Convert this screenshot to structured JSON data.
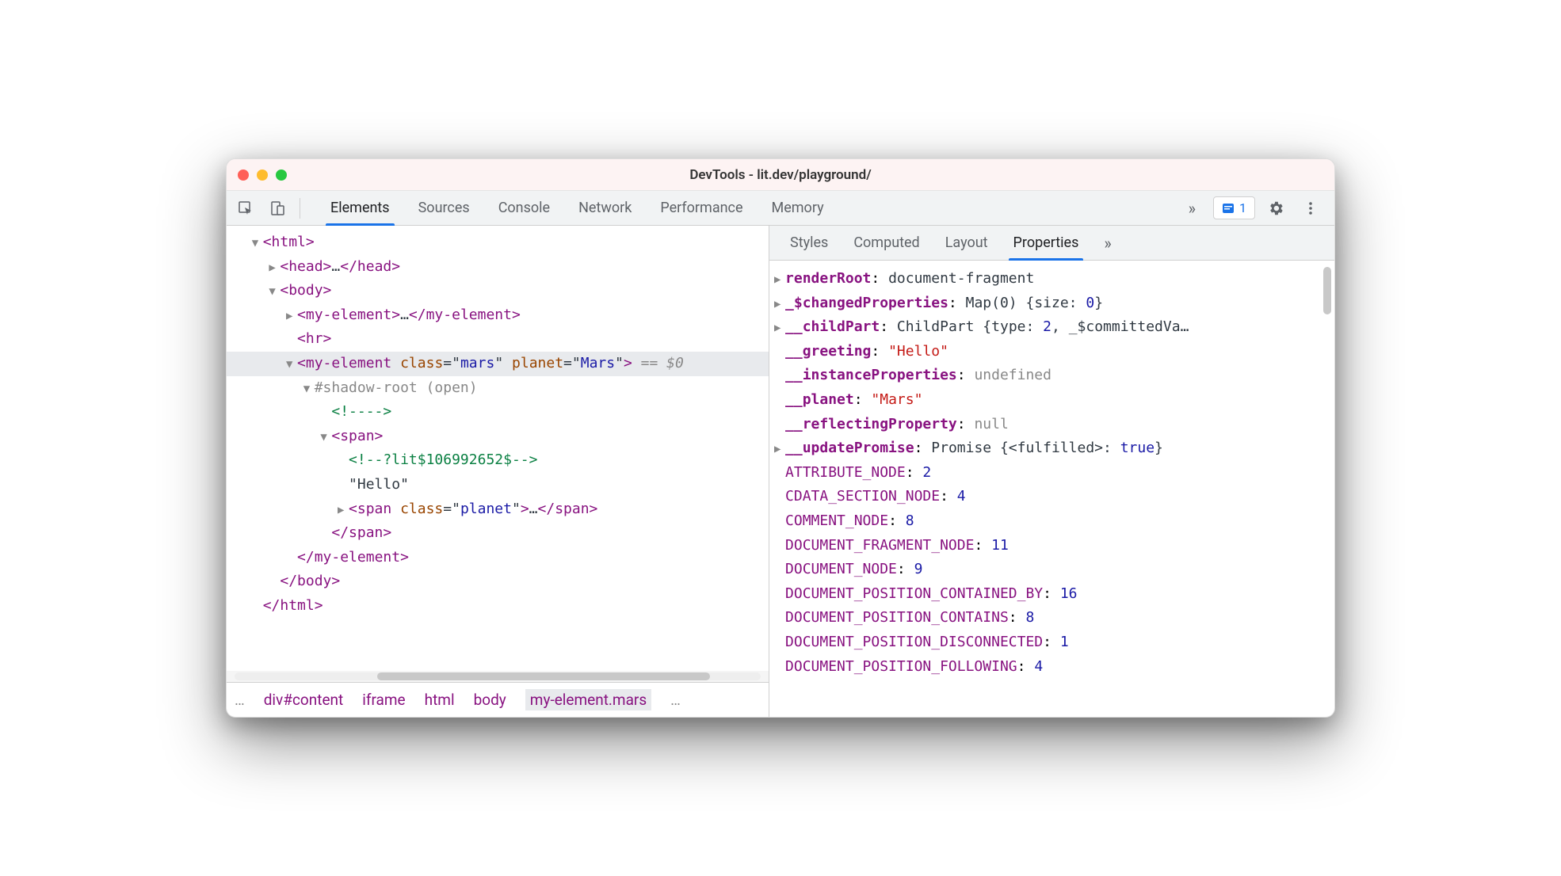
{
  "window": {
    "title": "DevTools - lit.dev/playground/"
  },
  "toolbar": {
    "tabs": [
      "Elements",
      "Sources",
      "Console",
      "Network",
      "Performance",
      "Memory"
    ],
    "active_tab": 0,
    "overflow": "»",
    "issues_count": "1"
  },
  "dom": {
    "lines": [
      {
        "indent": 1,
        "arrow": "▼",
        "open": "<html>"
      },
      {
        "indent": 2,
        "arrow": "▶",
        "open": "<head>",
        "inner": "…",
        "close": "</head>"
      },
      {
        "indent": 2,
        "arrow": "▼",
        "open": "<body>"
      },
      {
        "indent": 3,
        "arrow": "▶",
        "open": "<my-element>",
        "inner": "…",
        "close": "</my-element>"
      },
      {
        "indent": 3,
        "arrow": " ",
        "open": "<hr>"
      },
      {
        "indent": 3,
        "arrow": "▼",
        "selected": true,
        "open_tag": "my-element",
        "attrs": [
          [
            "class",
            "mars"
          ],
          [
            "planet",
            "Mars"
          ]
        ],
        "suffix": " == $0"
      },
      {
        "indent": 4,
        "arrow": "▼",
        "shadow": "#shadow-root (open)"
      },
      {
        "indent": 5,
        "arrow": " ",
        "comment": "<!---->"
      },
      {
        "indent": 5,
        "arrow": "▼",
        "open": "<span>"
      },
      {
        "indent": 6,
        "arrow": " ",
        "comment": "<!--?lit$106992652$-->"
      },
      {
        "indent": 6,
        "arrow": " ",
        "text": "\"Hello\""
      },
      {
        "indent": 6,
        "arrow": "▶",
        "open_tag": "span",
        "attrs": [
          [
            "class",
            "planet"
          ]
        ],
        "inner": "…",
        "close": "</span>"
      },
      {
        "indent": 5,
        "arrow": " ",
        "open": "</span>"
      },
      {
        "indent": 3,
        "arrow": " ",
        "open": "</my-element>"
      },
      {
        "indent": 2,
        "arrow": " ",
        "open": "</body>"
      },
      {
        "indent": 1,
        "arrow": " ",
        "open": "</html>"
      }
    ]
  },
  "breadcrumb": {
    "ellipsis_left": "…",
    "items": [
      "div#content",
      "iframe",
      "html",
      "body",
      "my-element.mars"
    ],
    "selected": 4,
    "ellipsis_right": "…"
  },
  "sidebar": {
    "tabs": [
      "Styles",
      "Computed",
      "Layout",
      "Properties"
    ],
    "active_tab": 3,
    "overflow": "»"
  },
  "properties": [
    {
      "arrow": "▶",
      "key": "renderRoot",
      "bold": true,
      "val_class": "document-fragment"
    },
    {
      "arrow": "▶",
      "key": "_$changedProperties",
      "bold": true,
      "val_class": "Map(0)",
      "val_extra": " {size: ",
      "val_num": "0",
      "val_extra2": "}"
    },
    {
      "arrow": "▶",
      "key": "__childPart",
      "bold": true,
      "val_class": "ChildPart",
      "val_extra": " {type: ",
      "val_num": "2",
      "val_extra2": ", _$committedVa…"
    },
    {
      "arrow": " ",
      "key": "__greeting",
      "bold": true,
      "val_str": "\"Hello\""
    },
    {
      "arrow": " ",
      "key": "__instanceProperties",
      "bold": true,
      "val_undef": "undefined"
    },
    {
      "arrow": " ",
      "key": "__planet",
      "bold": true,
      "val_str": "\"Mars\""
    },
    {
      "arrow": " ",
      "key": "__reflectingProperty",
      "bold": true,
      "val_undef": "null"
    },
    {
      "arrow": "▶",
      "key": "__updatePromise",
      "bold": true,
      "val_class": "Promise",
      "val_extra": " {<fulfilled>: ",
      "val_bool": "true",
      "val_extra2": "}"
    },
    {
      "arrow": " ",
      "key": "ATTRIBUTE_NODE",
      "val_num": "2"
    },
    {
      "arrow": " ",
      "key": "CDATA_SECTION_NODE",
      "val_num": "4"
    },
    {
      "arrow": " ",
      "key": "COMMENT_NODE",
      "val_num": "8"
    },
    {
      "arrow": " ",
      "key": "DOCUMENT_FRAGMENT_NODE",
      "val_num": "11"
    },
    {
      "arrow": " ",
      "key": "DOCUMENT_NODE",
      "val_num": "9"
    },
    {
      "arrow": " ",
      "key": "DOCUMENT_POSITION_CONTAINED_BY",
      "val_num": "16"
    },
    {
      "arrow": " ",
      "key": "DOCUMENT_POSITION_CONTAINS",
      "val_num": "8"
    },
    {
      "arrow": " ",
      "key": "DOCUMENT_POSITION_DISCONNECTED",
      "val_num": "1"
    },
    {
      "arrow": " ",
      "key": "DOCUMENT_POSITION_FOLLOWING",
      "val_num": "4"
    }
  ]
}
